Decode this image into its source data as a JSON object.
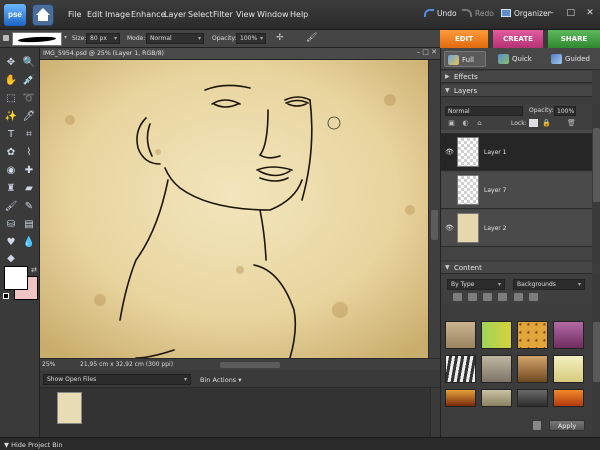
{
  "app": {
    "logo": "pse"
  },
  "menu": [
    "File",
    "Edit",
    "Image",
    "Enhance",
    "Layer",
    "Select",
    "Filter",
    "View",
    "Window",
    "Help"
  ],
  "top_right": {
    "undo": "Undo",
    "redo": "Redo",
    "organizer": "Organizer"
  },
  "window_controls": {
    "minimize": "–",
    "restore": "□",
    "close": "✕"
  },
  "options": {
    "size_label": "Size:",
    "size_value": "80 px",
    "mode_label": "Mode:",
    "mode_value": "Normal",
    "opacity_label": "Opacity:",
    "opacity_value": "100%"
  },
  "mode_tabs": {
    "edit": "EDIT",
    "create": "CREATE",
    "share": "SHARE"
  },
  "edit_subtabs": {
    "full": "Full",
    "quick": "Quick",
    "guided": "Guided"
  },
  "document": {
    "title": "IMG_5954.psd @ 25% (Layer 1, RGB/8)",
    "controls": "– □ ✕",
    "zoom": "25%",
    "size_info": "21,95 cm x 32,92 cm (300 ppi)"
  },
  "colors": {
    "foreground": "#ffffff",
    "background": "#f1c4c4",
    "accent_edit": "#f07d1c",
    "accent_create": "#cc4789",
    "accent_share": "#44a244",
    "selected_layer": "#262626"
  },
  "project_bin": {
    "show_select": "Show Open Files",
    "bin_actions": "Bin Actions",
    "hide_label": "Hide Project Bin"
  },
  "panels": {
    "effects": "Effects",
    "layers": "Layers",
    "blend_mode": "Normal",
    "opacity_label": "Opacity:",
    "opacity_value": "100%",
    "lock_label": "Lock:",
    "layer_rows": [
      {
        "name": "Layer 1",
        "selected": true,
        "visible": true
      },
      {
        "name": "Layer 7",
        "selected": false,
        "visible": false
      },
      {
        "name": "Layer 2",
        "selected": false,
        "visible": true
      }
    ],
    "content": "Content",
    "content_filter_type": "By Type",
    "content_filter_category": "Backgrounds",
    "apply": "Apply"
  },
  "icons": {
    "toolbox": [
      "move-icon",
      "zoom-icon",
      "hand-icon",
      "eyedropper-icon",
      "marquee-icon",
      "lasso-icon",
      "magic-wand-icon",
      "quick-selection-icon",
      "type-icon",
      "crop-icon",
      "cookie-cutter-icon",
      "straighten-icon",
      "red-eye-icon",
      "spot-healing-icon",
      "clone-stamp-icon",
      "eraser-icon",
      "brush-icon",
      "smart-brush-icon",
      "paint-bucket-icon",
      "gradient-icon",
      "shape-icon",
      "blur-icon",
      "sponge-icon"
    ]
  }
}
